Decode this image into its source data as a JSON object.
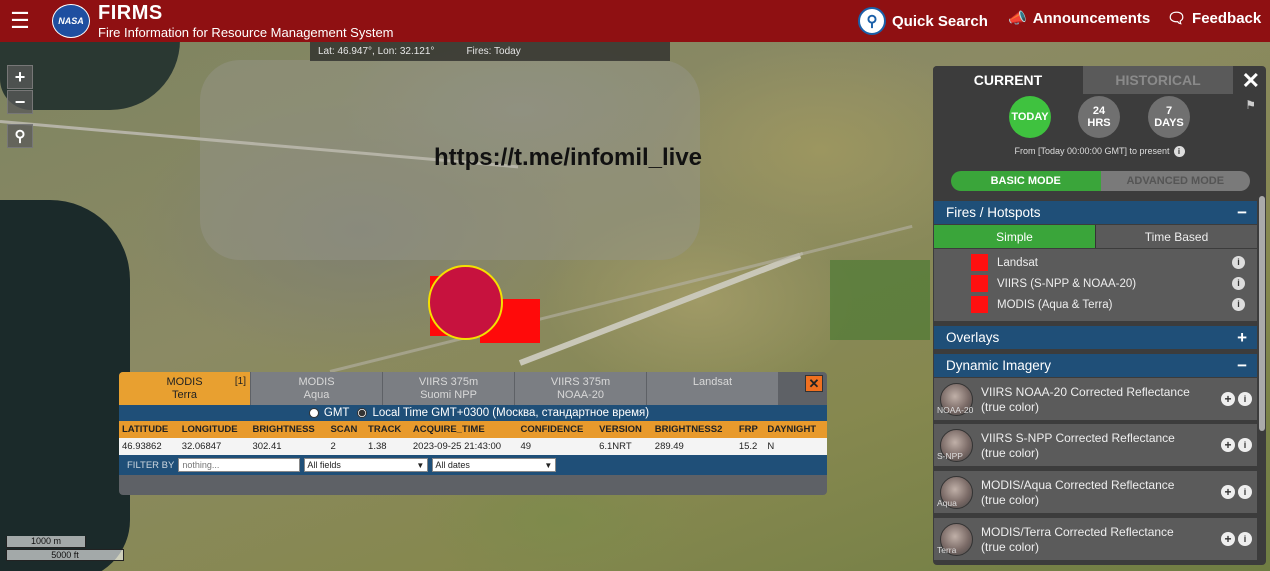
{
  "header": {
    "nasa_logo": "NASA",
    "title": "FIRMS",
    "subtitle": "Fire Information for Resource Management System",
    "quick_search": "Quick Search",
    "announcements": "Announcements",
    "feedback": "Feedback"
  },
  "coords": {
    "latlon": "Lat: 46.947°, Lon: 32.121°",
    "fires": "Fires: Today"
  },
  "watermark": "https://t.me/infomil_live",
  "scale": {
    "metric": "1000 m",
    "imperial": "5000 ft"
  },
  "popup": {
    "tabs": [
      {
        "label": "MODIS",
        "sub": "Terra",
        "count": "[1]"
      },
      {
        "label": "MODIS",
        "sub": "Aqua",
        "count": ""
      },
      {
        "label": "VIIRS 375m",
        "sub": "Suomi NPP",
        "count": ""
      },
      {
        "label": "VIIRS 375m",
        "sub": "NOAA-20",
        "count": ""
      },
      {
        "label": "Landsat",
        "sub": "",
        "count": ""
      }
    ],
    "close": "✕",
    "time_gmt": "GMT",
    "time_local": "Local Time GMT+0300 (Москва, стандартное время)",
    "columns": [
      "LATITUDE",
      "LONGITUDE",
      "BRIGHTNESS",
      "SCAN",
      "TRACK",
      "ACQUIRE_TIME",
      "CONFIDENCE",
      "VERSION",
      "BRIGHTNESS2",
      "FRP",
      "DAYNIGHT"
    ],
    "row": [
      "46.93862",
      "32.06847",
      "302.41",
      "2",
      "1.38",
      "2023-09-25 21:43:00",
      "49",
      "6.1NRT",
      "289.49",
      "15.2",
      "N"
    ],
    "filter_label": "FILTER BY",
    "filter_placeholder": "nothing...",
    "field_select": "All fields",
    "date_select": "All dates"
  },
  "panel": {
    "tab_current": "CURRENT",
    "tab_historical": "HISTORICAL",
    "range_today": "TODAY",
    "range_24_a": "24",
    "range_24_b": "HRS",
    "range_7_a": "7",
    "range_7_b": "DAYS",
    "from_text": "From [Today 00:00:00 GMT] to present",
    "mode_basic": "BASIC MODE",
    "mode_advanced": "ADVANCED MODE",
    "fires_header": "Fires / Hotspots",
    "sub_simple": "Simple",
    "sub_time": "Time Based",
    "fire_layers": [
      "Landsat",
      "VIIRS (S-NPP & NOAA-20)",
      "MODIS (Aqua & Terra)"
    ],
    "overlays_header": "Overlays",
    "dynamic_header": "Dynamic Imagery",
    "imagery": [
      {
        "thumb": "NOAA-20",
        "label": "VIIRS NOAA-20 Corrected Reflectance (true color)"
      },
      {
        "thumb": "S-NPP",
        "label": "VIIRS S-NPP Corrected Reflectance (true color)"
      },
      {
        "thumb": "Aqua",
        "label": "MODIS/Aqua Corrected Reflectance (true color)"
      },
      {
        "thumb": "Terra",
        "label": "MODIS/Terra Corrected Reflectance (true color)"
      }
    ]
  },
  "colors": {
    "header_bg": "#8f1012",
    "section_blue": "#1f4f78",
    "active_green": "#3aa53a",
    "fire_red": "#ff0a0a",
    "popup_orange": "#e89a2c"
  }
}
